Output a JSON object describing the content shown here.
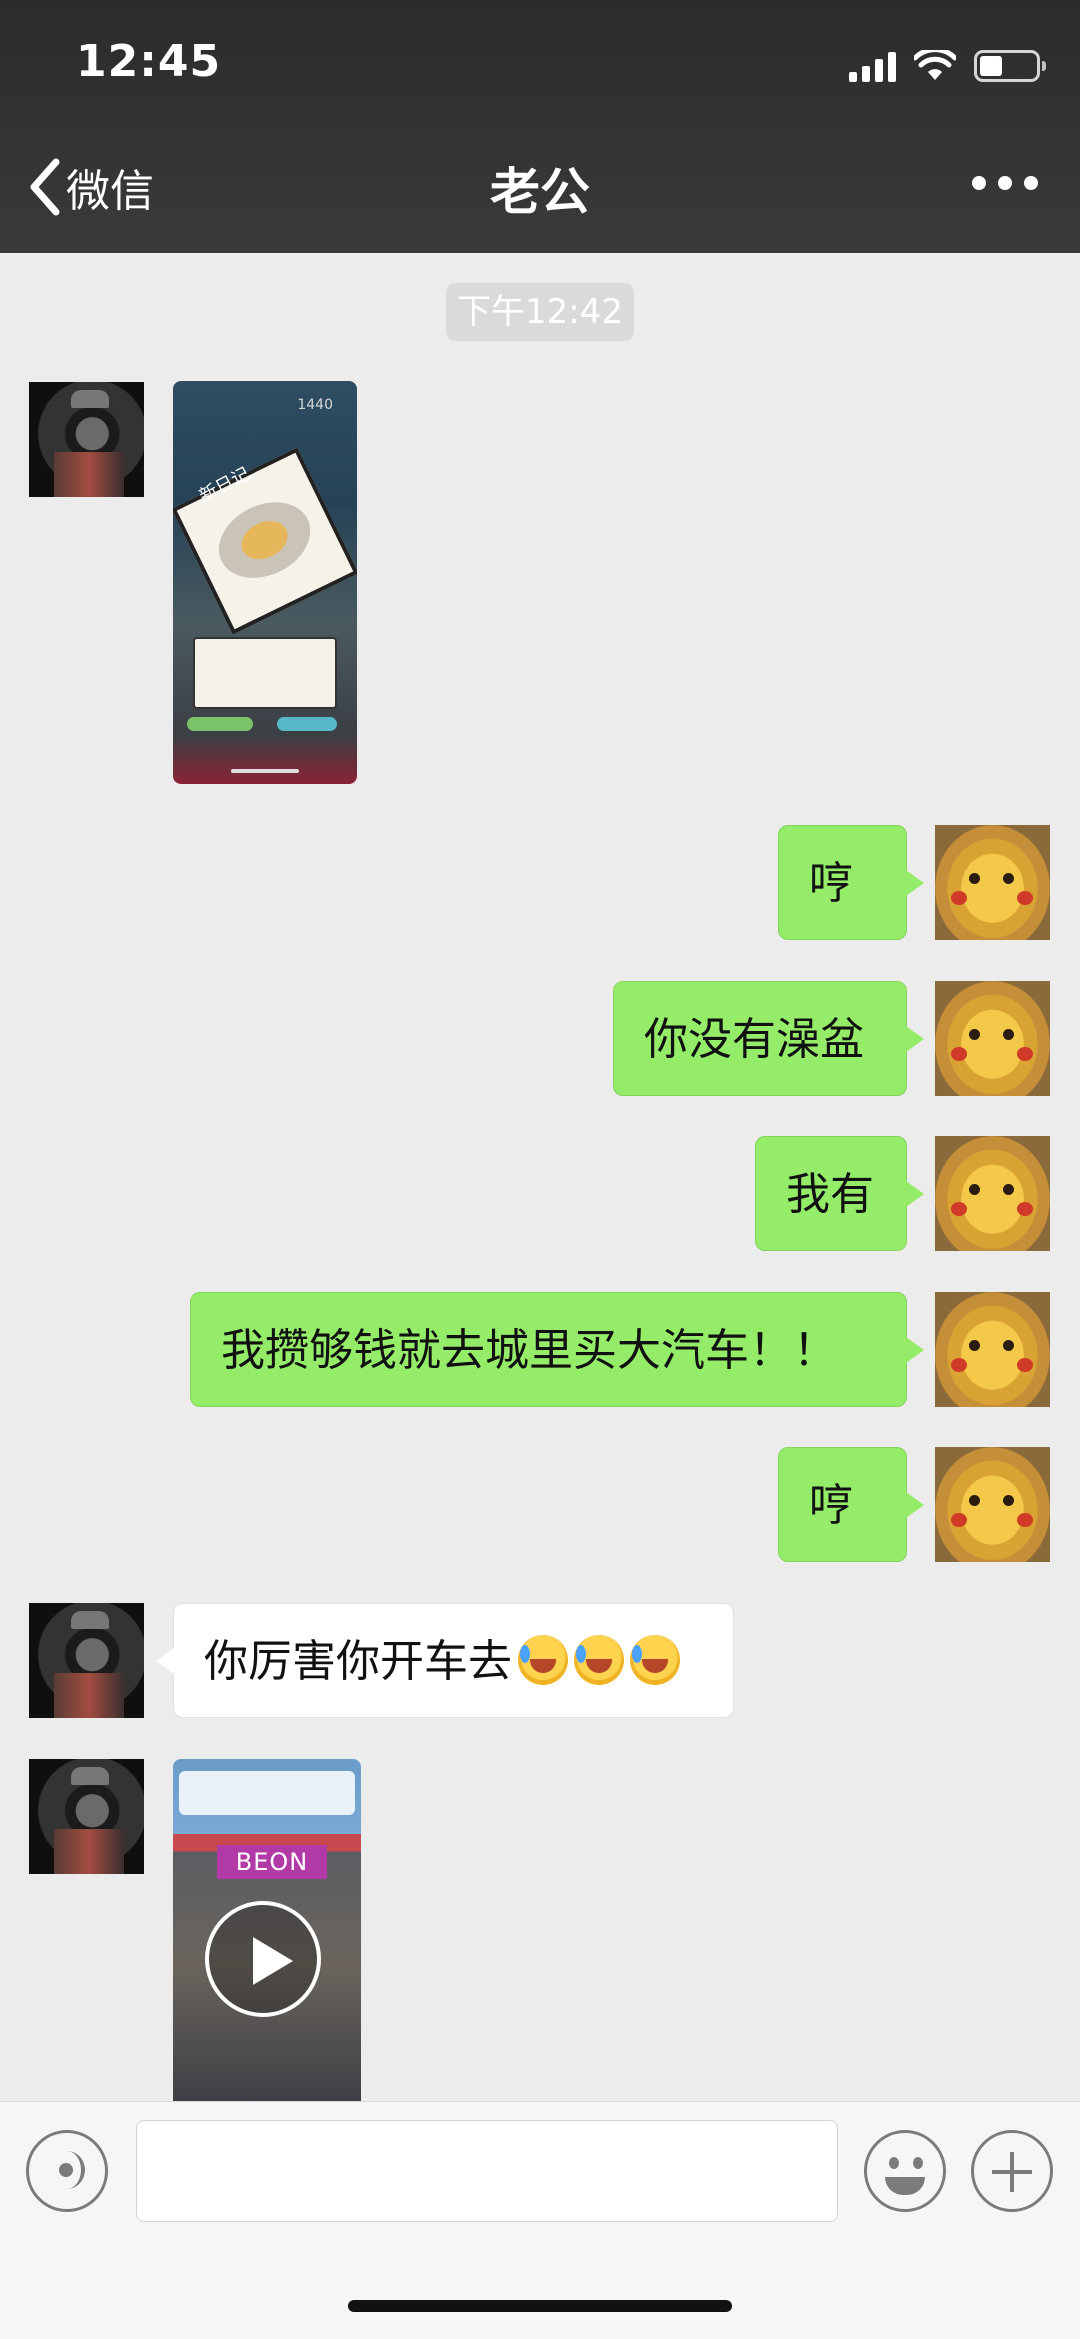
{
  "status_bar": {
    "time": "12:45",
    "icons": [
      "cellular-signal-icon",
      "wifi-icon",
      "battery-icon"
    ],
    "battery_level": 0.4
  },
  "nav": {
    "back_label": "微信",
    "title": "老公",
    "more_icon": "more-icon"
  },
  "chat": {
    "timestamp": "下午12:42",
    "messages": [
      {
        "sender": "them",
        "type": "image"
      },
      {
        "sender": "me",
        "type": "text",
        "text": "哼"
      },
      {
        "sender": "me",
        "type": "text",
        "text": "你没有澡盆"
      },
      {
        "sender": "me",
        "type": "text",
        "text": "我有"
      },
      {
        "sender": "me",
        "type": "text",
        "text": "我攒够钱就去城里买大汽车！！"
      },
      {
        "sender": "me",
        "type": "text",
        "text": "哼"
      },
      {
        "sender": "them",
        "type": "text",
        "text": "你厉害你开车去",
        "emojis": [
          "crying-laughing-emoji",
          "crying-laughing-emoji",
          "crying-laughing-emoji"
        ]
      },
      {
        "sender": "them",
        "type": "video"
      }
    ]
  },
  "thumb1": {
    "score": "1440",
    "diary_title": "新日记"
  },
  "thumb2": {
    "sign": "BEON"
  },
  "input_bar": {
    "placeholder": "",
    "buttons": [
      "voice-icon",
      "emoji-icon",
      "plus-icon"
    ]
  },
  "colors": {
    "header_bg": "#2f2f31",
    "chat_bg": "#ececec",
    "my_bubble": "#95ec69",
    "their_bubble": "#ffffff"
  }
}
